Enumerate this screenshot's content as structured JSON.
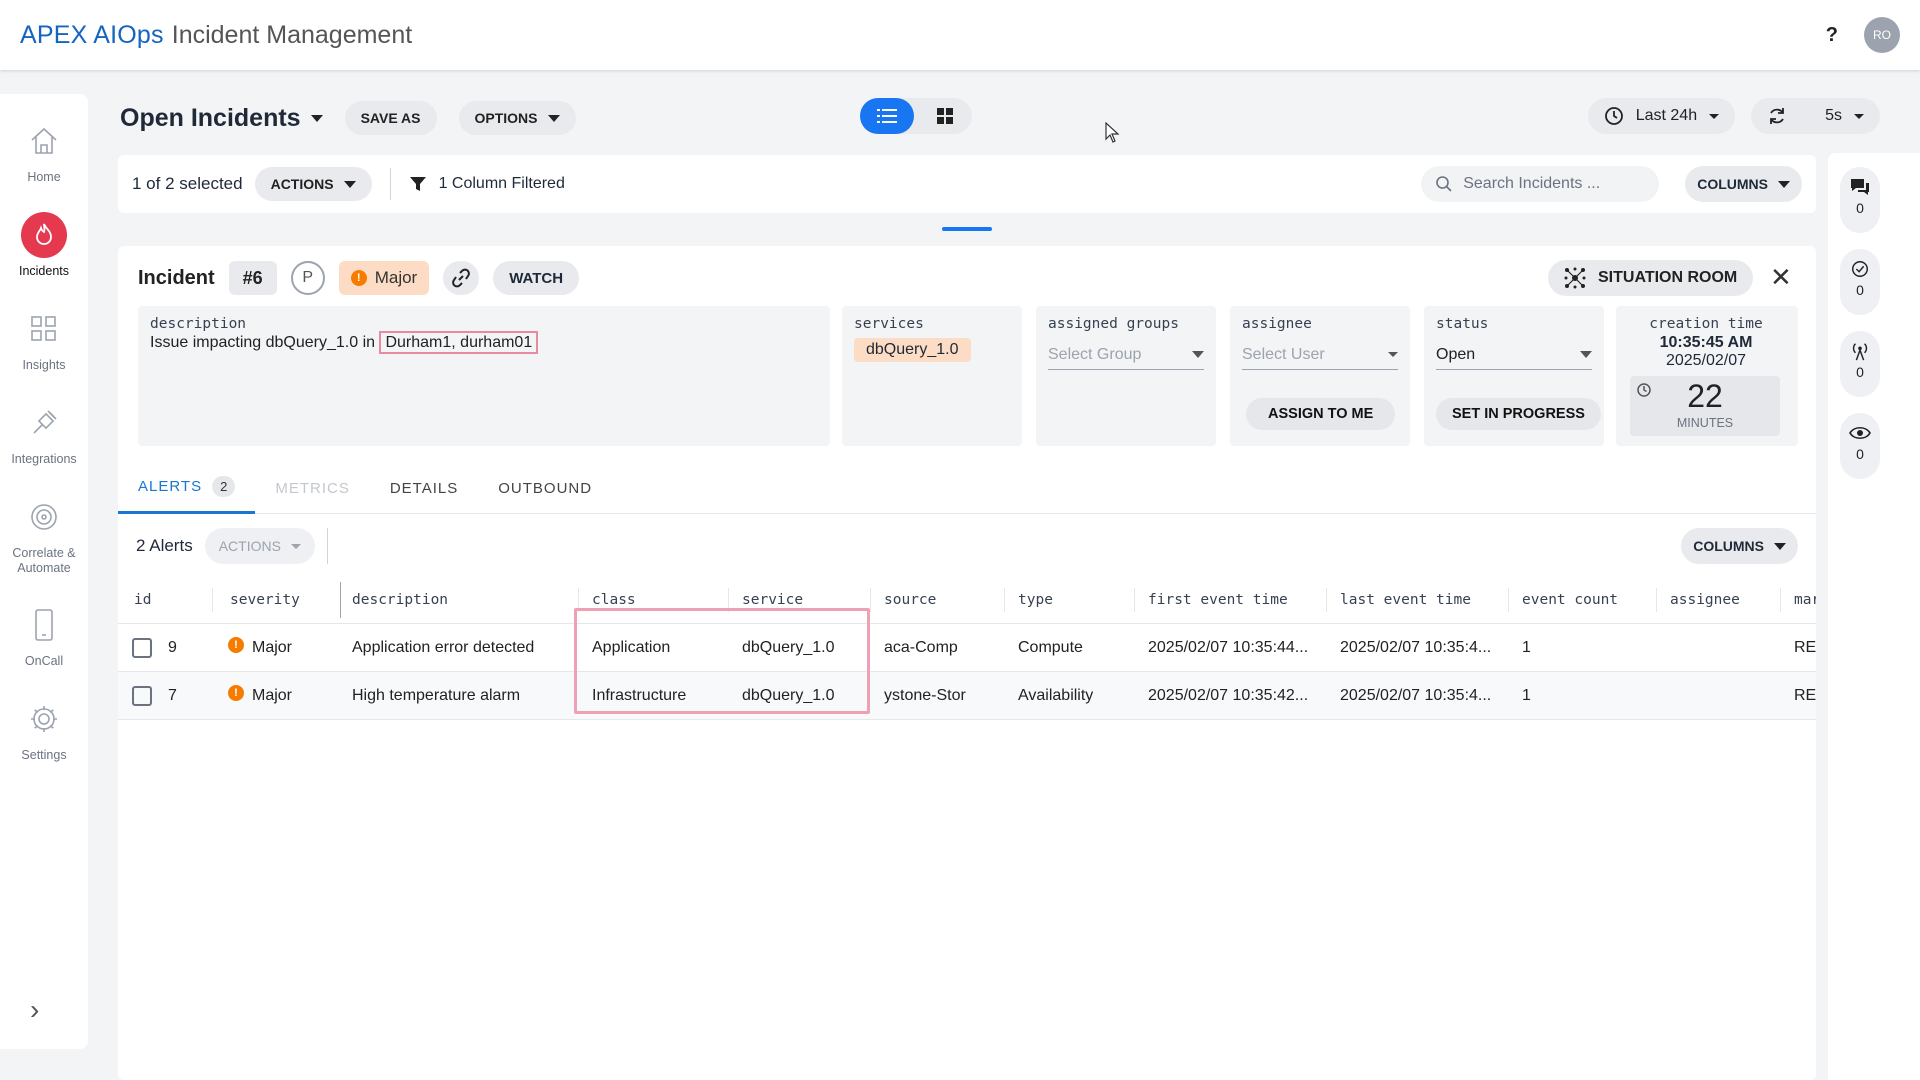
{
  "app": {
    "brand": "APEX AIOps",
    "subtitle": "Incident Management",
    "help": "?",
    "avatar": "RO"
  },
  "sidebar": {
    "items": [
      {
        "label": "Home",
        "icon": "home-icon"
      },
      {
        "label": "Incidents",
        "icon": "flame-icon",
        "active": true
      },
      {
        "label": "Insights",
        "icon": "grid-icon"
      },
      {
        "label": "Integrations",
        "icon": "plug-icon"
      },
      {
        "label": "Correlate &\nAutomate",
        "icon": "target-icon"
      },
      {
        "label": "OnCall",
        "icon": "phone-icon"
      },
      {
        "label": "Settings",
        "icon": "gear-icon"
      }
    ],
    "expand": "›"
  },
  "toolbar": {
    "title": "Open Incidents",
    "save_as": "SAVE AS",
    "options": "OPTIONS",
    "time_range": "Last 24h",
    "refresh_interval": "5s"
  },
  "selection": {
    "count_text": "1 of 2 selected",
    "actions": "ACTIONS",
    "filter_text": "1 Column Filtered",
    "search_placeholder": "Search Incidents ...",
    "columns": "COLUMNS"
  },
  "rail": [
    {
      "icon": "chat-icon",
      "count": "0"
    },
    {
      "icon": "check-badge-icon",
      "count": "0"
    },
    {
      "icon": "broadcast-icon",
      "count": "0"
    },
    {
      "icon": "eye-icon",
      "count": "0"
    }
  ],
  "incident": {
    "label": "Incident",
    "number": "#6",
    "priority": "P",
    "severity": "Major",
    "watch": "WATCH",
    "situation_room": "SITUATION ROOM",
    "description_label": "description",
    "description_prefix": "Issue impacting dbQuery_1.0 in ",
    "description_highlight": "Durham1, durham01",
    "services_label": "services",
    "service": "dbQuery_1.0",
    "groups_label": "assigned groups",
    "groups_placeholder": "Select Group",
    "assignee_label": "assignee",
    "assignee_placeholder": "Select User",
    "assign_to_me": "ASSIGN TO ME",
    "status_label": "status",
    "status_value": "Open",
    "set_in_progress": "SET IN PROGRESS",
    "creation_label": "creation time",
    "creation_time": "10:35:45 AM",
    "creation_date": "2025/02/07",
    "age_value": "22",
    "age_unit": "MINUTES"
  },
  "tabs": [
    {
      "label": "ALERTS",
      "badge": "2",
      "state": "active"
    },
    {
      "label": "METRICS",
      "state": "disabled"
    },
    {
      "label": "DETAILS",
      "state": "normal"
    },
    {
      "label": "OUTBOUND",
      "state": "normal"
    }
  ],
  "alerts": {
    "count_text": "2 Alerts",
    "actions": "ACTIONS",
    "columns": "COLUMNS",
    "headers": [
      "id",
      "severity",
      "description",
      "class",
      "service",
      "source",
      "type",
      "first event time",
      "last event time",
      "event count",
      "assignee",
      "mar"
    ],
    "rows": [
      [
        "9",
        "Major",
        "Application error detected",
        "Application",
        "dbQuery_1.0",
        "aca-Comp",
        "Compute",
        "2025/02/07 10:35:44...",
        "2025/02/07 10:35:4...",
        "1",
        "",
        "RE:"
      ],
      [
        "7",
        "Major",
        "High temperature alarm",
        "Infrastructure",
        "dbQuery_1.0",
        "ystone-Stor",
        "Availability",
        "2025/02/07 10:35:42...",
        "2025/02/07 10:35:4...",
        "1",
        "",
        "RE:"
      ]
    ]
  },
  "colors": {
    "brand": "#1565c0",
    "accent": "#1976f2",
    "active_nav": "#e53950",
    "major": "#f57c00",
    "highlight": "#f0a0b4"
  }
}
